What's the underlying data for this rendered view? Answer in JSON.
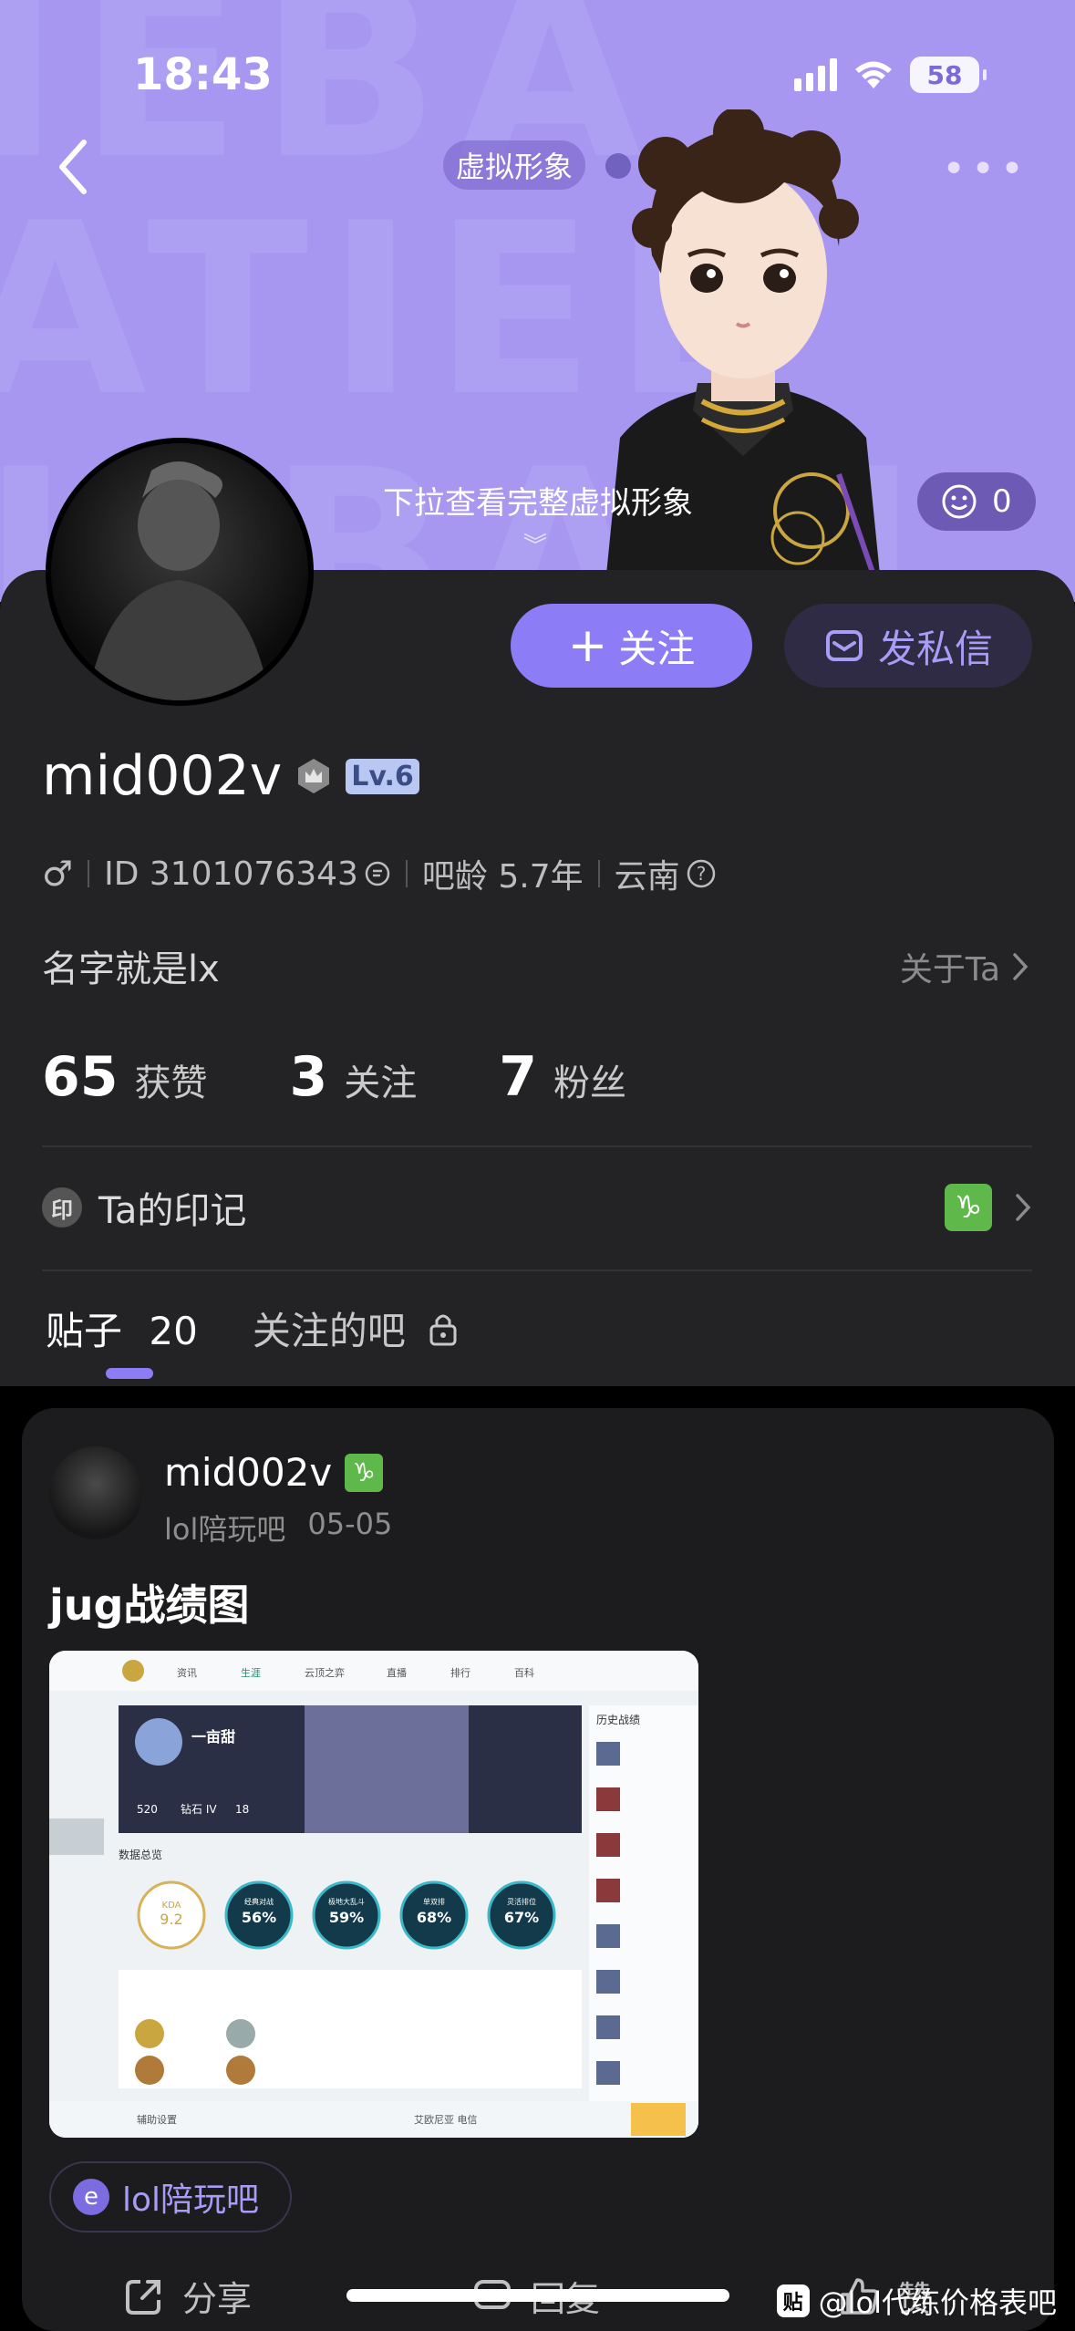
{
  "status_bar": {
    "time": "18:43",
    "battery": "58"
  },
  "header": {
    "avatar_chip": "虚拟形象",
    "pull_hint": "下拉查看完整虚拟形象",
    "like_count": "0"
  },
  "profile": {
    "follow_label": "关注",
    "message_label": "发私信",
    "username": "mid002v",
    "level": "Lv.6",
    "id_text": "ID 3101076343",
    "age_text": "吧龄 5.7年",
    "location": "云南",
    "bio": "名字就是lx",
    "about_label": "关于Ta",
    "stats": [
      {
        "num": "65",
        "label": "获赞"
      },
      {
        "num": "3",
        "label": "关注"
      },
      {
        "num": "7",
        "label": "粉丝"
      }
    ],
    "mark_icon": "印",
    "mark_label": "Ta的印记",
    "zodiac": "♑"
  },
  "tabs": {
    "posts_label": "贴子",
    "posts_count": "20",
    "followed_label": "关注的吧"
  },
  "post": {
    "username": "mid002v",
    "forum": "lol陪玩吧",
    "date": "05-05",
    "title": "jug战绩图",
    "forum_chip": "lol陪玩吧",
    "share_label": "分享",
    "reply_label": "回复",
    "like_label": "赞"
  },
  "image_content": {
    "nav": [
      "资讯",
      "生涯",
      "云顶之弈",
      "直播",
      "排行",
      "百科"
    ],
    "player_name": "一亩甜",
    "stats_a": "520",
    "rank_a": "钻石 IV",
    "stats_b": "18",
    "history_title": "历史战绩",
    "section": "数据总览",
    "kda_label": "KDA",
    "kda_value": "9.2",
    "circles": [
      {
        "label": "经典对战",
        "pct": "56%"
      },
      {
        "label": "极地大乱斗",
        "pct": "59%"
      },
      {
        "label": "单双排",
        "pct": "68%"
      },
      {
        "label": "灵活排位",
        "pct": "67%"
      }
    ],
    "footer_left": "辅助设置",
    "footer_right": "艾欧尼亚 电信"
  },
  "watermark": {
    "text": "@lol代练价格表吧",
    "logo": "贴"
  },
  "colors": {
    "hero": "#a797f1",
    "accent": "#8c7cf5",
    "panel": "#232325",
    "card": "#1c1c1e"
  }
}
